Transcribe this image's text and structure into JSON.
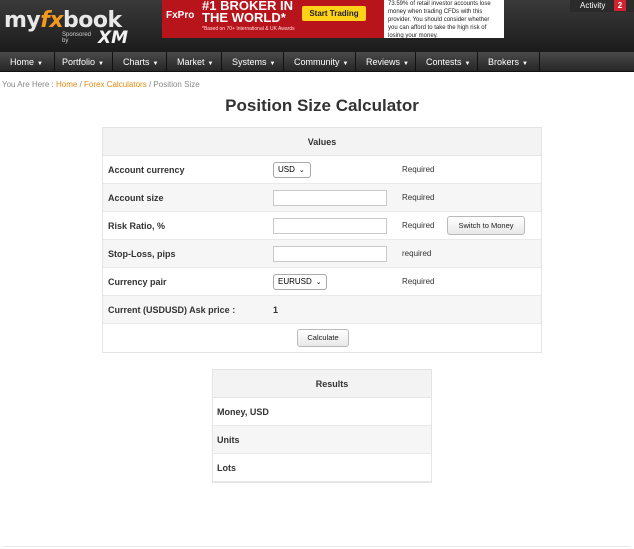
{
  "header": {
    "logo": {
      "part1": "my",
      "part2": "fx",
      "part3": "book"
    },
    "sponsor": {
      "label": "Sponsored by",
      "brand": "XM"
    },
    "ad": {
      "brand": "FxPro",
      "headline": "#1 BROKER IN THE WORLD*",
      "subline": "*Based on 70+ International & UK Awards",
      "cta": "Start Trading",
      "risk": "73.59% of retail investor accounts lose money when trading CFDs with this provider. You should consider whether you can afford to take the high risk of losing your money."
    },
    "activity": {
      "label": "Activity",
      "count": "2"
    }
  },
  "nav": {
    "items": [
      {
        "label": "Home"
      },
      {
        "label": "Portfolio"
      },
      {
        "label": "Charts"
      },
      {
        "label": "Market"
      },
      {
        "label": "Systems"
      },
      {
        "label": "Community"
      },
      {
        "label": "Reviews"
      },
      {
        "label": "Contests"
      },
      {
        "label": "Brokers"
      }
    ]
  },
  "breadcrumb": {
    "prefix": "You Are Here :",
    "home": "Home",
    "sep": "/",
    "section": "Forex Calculators",
    "current": "Position Size"
  },
  "page_title": "Position Size Calculator",
  "calculator": {
    "header": "Values",
    "account_currency": {
      "label": "Account currency",
      "value": "USD",
      "note": "Required"
    },
    "account_size": {
      "label": "Account size",
      "value": "",
      "note": "Required"
    },
    "risk_ratio": {
      "label": "Risk Ratio, %",
      "value": "",
      "note": "Required",
      "button": "Switch to Money"
    },
    "stop_loss": {
      "label": "Stop-Loss, pips",
      "value": "",
      "note": "required"
    },
    "currency_pair": {
      "label": "Currency pair",
      "value": "EURUSD",
      "note": "Required"
    },
    "ask_price": {
      "label": "Current (USDUSD) Ask price :",
      "value": "1"
    },
    "calculate_button": "Calculate"
  },
  "results": {
    "header": "Results",
    "rows": [
      "Money, USD",
      "Units",
      "Lots"
    ]
  }
}
